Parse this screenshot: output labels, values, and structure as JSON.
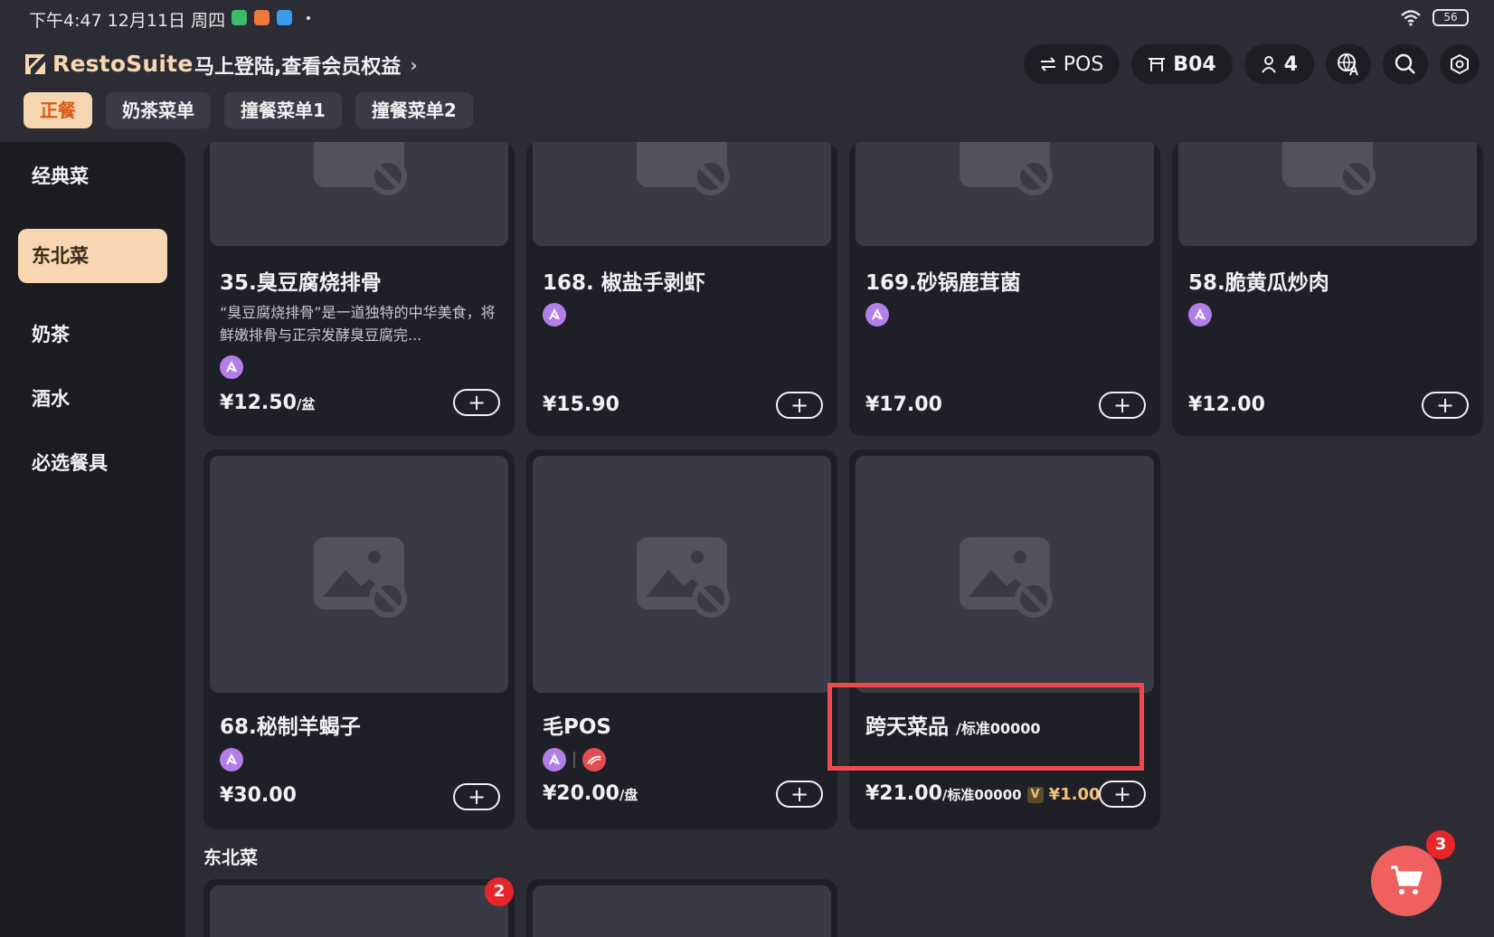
{
  "status_bar": {
    "time": "下午4:47 12月11日 周四",
    "battery": "56"
  },
  "header": {
    "brand": "RestoSuite",
    "login_prompt": "马上登陆,查看会员权益",
    "pos_label": "POS",
    "table_label": "B04",
    "guest_count": "4"
  },
  "menu_tabs": [
    {
      "label": "正餐",
      "active": true
    },
    {
      "label": "奶茶菜单",
      "active": false
    },
    {
      "label": "撞餐菜单1",
      "active": false
    },
    {
      "label": "撞餐菜单2",
      "active": false
    }
  ],
  "categories": [
    {
      "label": "经典菜",
      "active": false
    },
    {
      "label": "东北菜",
      "active": true
    },
    {
      "label": "奶茶",
      "active": false
    },
    {
      "label": "酒水",
      "active": false
    },
    {
      "label": "必选餐具",
      "active": false
    }
  ],
  "dishes": [
    {
      "name": "35.臭豆腐烧排骨",
      "desc": "“臭豆腐烧排骨”是一道独特的中华美食，将鲜嫩排骨与正宗发酵臭豆腐完...",
      "price": "¥12.50",
      "unit": "/盆"
    },
    {
      "name": "168. 椒盐手剥虾",
      "price": "¥15.90"
    },
    {
      "name": "169.砂锅鹿茸菌",
      "price": "¥17.00"
    },
    {
      "name": "58.脆黄瓜炒肉",
      "price": "¥12.00"
    },
    {
      "name": "68.秘制羊蝎子",
      "price": "¥30.00"
    },
    {
      "name": "毛POS",
      "price": "¥20.00",
      "unit": "/盘"
    },
    {
      "name": "跨天菜品",
      "spec": "/标准00000",
      "price": "¥21.00",
      "unit": "/标准00000",
      "vip_badge": "V",
      "vip_price": "¥1.00"
    }
  ],
  "section_title": "东北菜",
  "section_card_badge": "2",
  "cart_count": "3",
  "colors": {
    "accent": "#f6d7b2",
    "highlight": "#ef4b4f",
    "cart": "#f0605f"
  }
}
